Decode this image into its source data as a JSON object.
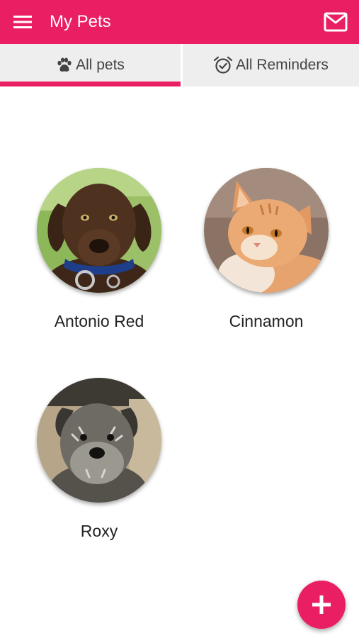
{
  "app_bar": {
    "title": "My Pets",
    "menu_icon": "hamburger-menu-icon",
    "mail_icon": "mail-envelope-icon"
  },
  "tabs": [
    {
      "label": "All pets",
      "icon": "paw-icon",
      "selected": true
    },
    {
      "label": "All Reminders",
      "icon": "alarm-clock-icon",
      "selected": false
    }
  ],
  "pets": [
    {
      "name": "Antonio Red",
      "photo": "chocolate labrador puppy with blue collar"
    },
    {
      "name": "Cinnamon",
      "photo": "orange tabby cat"
    },
    {
      "name": "Roxy",
      "photo": "grey schnauzer puppy"
    }
  ],
  "fab": {
    "icon": "plus-icon"
  },
  "colors": {
    "accent": "#E91E63",
    "tab_background": "#EEEEEE",
    "text": "#222222"
  }
}
